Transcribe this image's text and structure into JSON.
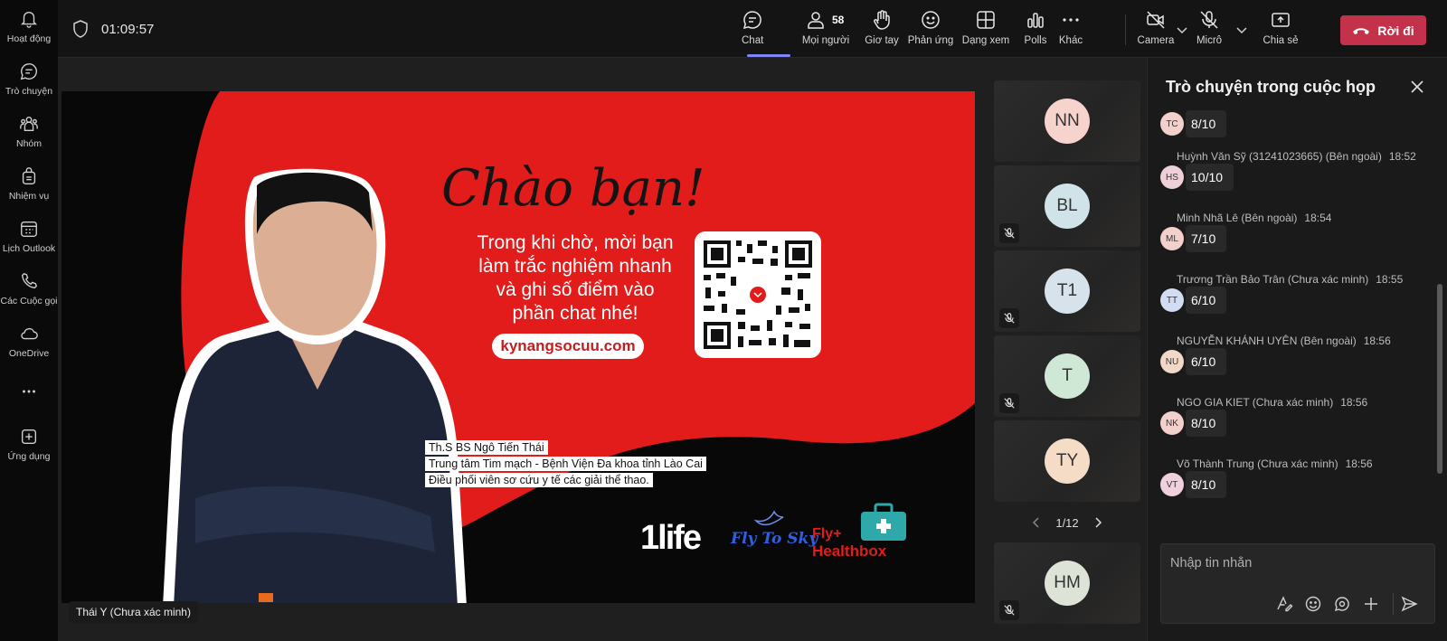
{
  "rail": {
    "items": [
      {
        "label": "Hoạt động",
        "icon": "bell-icon"
      },
      {
        "label": "Trò chuyện",
        "icon": "chat-icon"
      },
      {
        "label": "Nhóm",
        "icon": "teams-icon"
      },
      {
        "label": "Nhiệm vụ",
        "icon": "tasks-icon"
      },
      {
        "label": "Lịch Outlook",
        "icon": "calendar-icon"
      },
      {
        "label": "Các Cuộc gọi",
        "icon": "phone-icon"
      },
      {
        "label": "OneDrive",
        "icon": "cloud-icon"
      },
      {
        "label": "",
        "icon": "more-icon"
      },
      {
        "label": "Ứng dụng",
        "icon": "apps-icon"
      }
    ]
  },
  "topbar": {
    "timer": "01:09:57",
    "buttons": {
      "chat": "Chat",
      "people": "Mọi người",
      "people_count": "58",
      "raise": "Giơ tay",
      "react": "Phản ứng",
      "view": "Dạng xem",
      "polls": "Polls",
      "more": "Khác",
      "camera": "Camera",
      "mic": "Micrô",
      "share": "Chia sẻ"
    },
    "leave": "Rời đi",
    "colors": {
      "accent": "#7f85f5",
      "leave": "#c4314b"
    }
  },
  "slide": {
    "title": "Chào bạn!",
    "body": [
      "Trong khi chờ, mời bạn",
      "làm trắc nghiệm nhanh",
      "và ghi số điểm vào",
      "phần chat nhé!"
    ],
    "url": "kynangsocuu.com",
    "caption": [
      "Th.S BS Ngô Tiến Thái",
      "Trung tâm Tim mạch - Bệnh Viện Đa khoa tỉnh Lào Cai",
      "Điều phối viên sơ cứu y tế các giải thể thao."
    ],
    "logos": {
      "one_life": "1life",
      "fly_to_sky": "Fly To Sky",
      "healthbox_line1": "Fly+",
      "healthbox_line2": "Healthbox"
    },
    "colors": {
      "red": "#e21b1b"
    }
  },
  "stage": {
    "speaker_label": "Thái Y (Chưa xác minh)"
  },
  "participants": [
    {
      "initials": "NN",
      "color": "#f6d3cc",
      "muted": false
    },
    {
      "initials": "BL",
      "color": "#cfe3e8",
      "muted": true
    },
    {
      "initials": "T1",
      "color": "#d6e2ec",
      "muted": true
    },
    {
      "initials": "T",
      "color": "#cfe8d6",
      "muted": true
    },
    {
      "initials": "TY",
      "color": "#f5dcc7",
      "muted": false
    },
    {
      "initials": "HM",
      "color": "#dde3d6",
      "muted": true
    }
  ],
  "pager": {
    "label": "1/12"
  },
  "chat": {
    "title": "Trò chuyện trong cuộc họp",
    "messages": [
      {
        "sender": "",
        "time": "",
        "initials": "TC",
        "color": "#f3d0cc",
        "text": "8/10"
      },
      {
        "sender": "Huỳnh Văn Sỹ (31241023665) (Bên ngoài)",
        "time": "18:52",
        "initials": "HS",
        "color": "#f0d0d8",
        "text": "10/10"
      },
      {
        "sender": "Minh Nhã Lê (Bên ngoài)",
        "time": "18:54",
        "initials": "ML",
        "color": "#f3d0cc",
        "text": "7/10"
      },
      {
        "sender": "Trương Trần Bảo Trân (Chưa xác minh)",
        "time": "18:55",
        "initials": "TT",
        "color": "#d2dcf2",
        "text": "6/10"
      },
      {
        "sender": "NGUYỄN KHÁNH UYÊN (Bên ngoài)",
        "time": "18:56",
        "initials": "NU",
        "color": "#f3d8c8",
        "text": "6/10"
      },
      {
        "sender": "NGO GIA KIET (Chưa xác minh)",
        "time": "18:56",
        "initials": "NK",
        "color": "#f3d0cc",
        "text": "8/10"
      },
      {
        "sender": "Võ Thành Trung (Chưa xác minh)",
        "time": "18:56",
        "initials": "VT",
        "color": "#f0d0dc",
        "text": "8/10"
      }
    ],
    "compose_placeholder": "Nhập tin nhắn"
  }
}
